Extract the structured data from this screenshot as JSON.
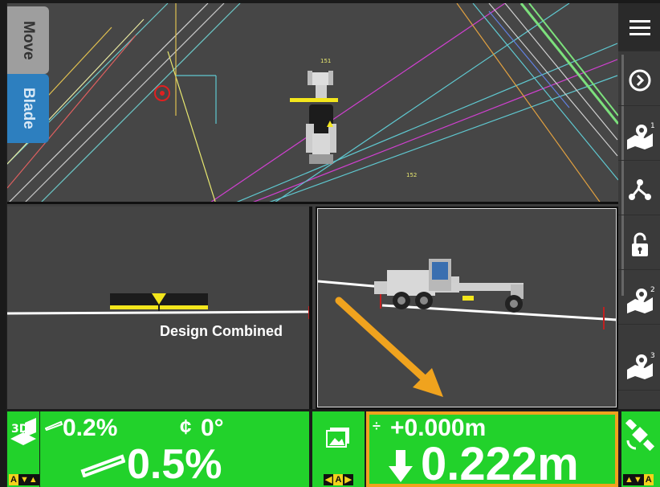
{
  "side_tabs": {
    "move": "Move",
    "blade": "Blade"
  },
  "plan_view": {
    "point_labels": [
      "151",
      "152"
    ]
  },
  "cross_section": {
    "label": "Design Combined"
  },
  "toolbar": {
    "items": [
      {
        "name": "menu",
        "icon": "hamburger-icon"
      },
      {
        "name": "next",
        "icon": "chevron-circle-right-icon"
      },
      {
        "name": "map-1",
        "icon": "map-pin-1-icon",
        "badge": "1"
      },
      {
        "name": "route",
        "icon": "route-icon"
      },
      {
        "name": "lock",
        "icon": "unlock-icon"
      },
      {
        "name": "map-2",
        "icon": "map-pin-2-icon",
        "badge": "2"
      },
      {
        "name": "map-3",
        "icon": "map-pin-3-icon",
        "badge": "3"
      }
    ]
  },
  "status": {
    "mode_icon_text": "3D",
    "mode_ctrl": "A",
    "cross_slope": "0.2%",
    "rotation": "0°",
    "main_slope": "0.5%",
    "view_ctrl": "A",
    "elevation_offset": "+0.000m",
    "cut_fill": "0.222m",
    "gps_ctrl": "A"
  },
  "colors": {
    "status_green": "#22d22b",
    "highlight_orange": "#f0a31e",
    "blade_yellow": "#f3e61c",
    "tab_blue": "#2d7fbf"
  }
}
